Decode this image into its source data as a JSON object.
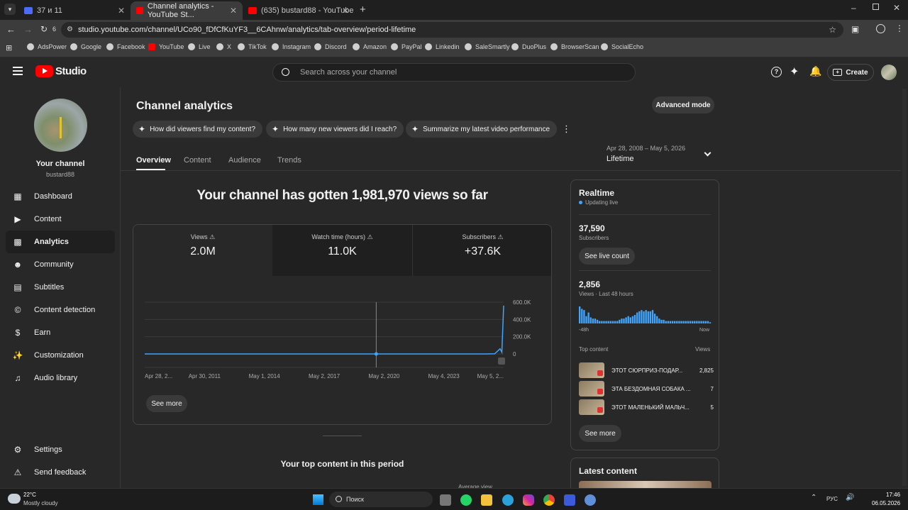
{
  "browser": {
    "tabs": [
      {
        "title": "37 и 11",
        "color": "#4a6cf7"
      },
      {
        "title": "Channel analytics - YouTube St...",
        "color": "#ff0000"
      },
      {
        "title": "(635) bustard88 - YouTube",
        "color": "#ff0000"
      }
    ],
    "new_tab": "+",
    "url": "studio.youtube.com/channel/UCo90_fDfCfKuYF3__6CAhnw/analytics/tab-overview/period-lifetime",
    "reload_count": "6",
    "bookmarks": [
      "AdsPower",
      "Google",
      "Facebook",
      "YouTube",
      "Live",
      "X",
      "TikTok",
      "Instagram",
      "Discord",
      "Amazon",
      "PayPal",
      "Linkedin",
      "SaleSmartly",
      "DuoPlus",
      "BrowserScan",
      "SocialEcho"
    ]
  },
  "studio": {
    "logo_text": "Studio",
    "search_placeholder": "Search across your channel",
    "create_label": "Create",
    "channel": {
      "title": "Your channel",
      "handle": "bustard88"
    },
    "nav": [
      "Dashboard",
      "Content",
      "Analytics",
      "Community",
      "Subtitles",
      "Content detection",
      "Earn",
      "Customization",
      "Audio library"
    ],
    "nav_bottom": [
      "Settings",
      "Send feedback"
    ],
    "page_title": "Channel analytics",
    "advanced_mode": "Advanced mode",
    "chips": [
      "How did viewers find my content?",
      "How many new viewers did I reach?",
      "Summarize my latest video performance"
    ],
    "tabs": [
      "Overview",
      "Content",
      "Audience",
      "Trends"
    ],
    "date_range": "Apr 28, 2008 – May 5, 2026",
    "period": "Lifetime",
    "headline": "Your channel has gotten 1,981,970 views so far",
    "metrics": [
      {
        "label": "Views",
        "value": "2.0M"
      },
      {
        "label": "Watch time (hours)",
        "value": "11.0K"
      },
      {
        "label": "Subscribers",
        "value": "+37.6K"
      }
    ],
    "see_more": "See more",
    "top_content_heading": "Your top content in this period",
    "avg_view": "Average view",
    "realtime": {
      "title": "Realtime",
      "status": "Updating live",
      "subs_value": "37,590",
      "subs_label": "Subscribers",
      "live_count_btn": "See live count",
      "views_value": "2,856",
      "views_label": "Views · Last 48 hours",
      "axis_left": "-48h",
      "axis_right": "Now",
      "top_content_label": "Top content",
      "views_col": "Views",
      "items": [
        {
          "title": "ЭТОТ СЮРПРИЗ-ПОДАР...",
          "views": "2,825"
        },
        {
          "title": "ЭТА БЕЗДОМНАЯ СОБАКА ...",
          "views": "7"
        },
        {
          "title": "ЭТОТ МАЛЕНЬКИЙ МАЛЬЧ...",
          "views": "5"
        }
      ],
      "see_more": "See more",
      "bars": [
        14,
        12,
        11,
        6,
        9,
        5,
        4,
        4,
        3,
        2,
        2,
        2,
        2,
        2,
        2,
        2,
        2,
        2,
        3,
        4,
        4,
        5,
        6,
        5,
        6,
        7,
        9,
        10,
        11,
        10,
        11,
        10,
        10,
        11,
        8,
        6,
        4,
        3,
        3,
        2,
        2,
        2,
        2,
        2,
        2,
        2,
        2,
        2,
        2,
        2,
        2,
        2,
        2,
        2,
        2,
        2,
        2,
        2,
        2,
        1
      ]
    },
    "latest_content": "Latest content",
    "accent": "#3ea6ff"
  },
  "chart_data": {
    "type": "line",
    "x_ticks": [
      "Apr 28, 2...",
      "Apr 30, 2011",
      "May 1, 2014",
      "May 2, 2017",
      "May 2, 2020",
      "May 4, 2023",
      "May 5, 2..."
    ],
    "y_ticks": [
      "600.0K",
      "400.0K",
      "200.0K",
      "0"
    ],
    "ylim": [
      0,
      600000
    ],
    "x_norm": [
      0.0,
      0.95,
      0.975,
      0.99,
      0.995,
      1.0
    ],
    "values": [
      0,
      0,
      2000,
      60000,
      20000,
      560000
    ]
  },
  "taskbar": {
    "weather_temp": "22°C",
    "weather_desc": "Mostly cloudy",
    "search_label": "Поиск",
    "lang": "РУС",
    "time": "17:46",
    "date": "06.05.2026"
  }
}
